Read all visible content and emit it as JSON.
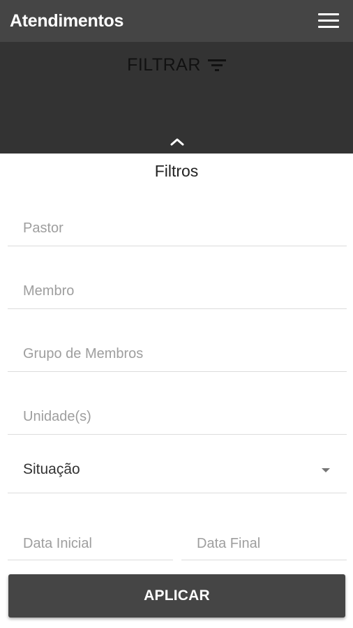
{
  "appbar": {
    "title": "Atendimentos",
    "menu_icon": "hamburger-menu-icon"
  },
  "filter_panel": {
    "label": "FILTRAR",
    "filter_icon": "filter-list-icon",
    "collapse_icon": "chevron-up-icon"
  },
  "form": {
    "title": "Filtros",
    "pastor": {
      "placeholder": "Pastor",
      "value": ""
    },
    "membro": {
      "placeholder": "Membro",
      "value": ""
    },
    "grupo": {
      "placeholder": "Grupo de Membros",
      "value": ""
    },
    "unidade": {
      "placeholder": "Unidade(s)",
      "value": ""
    },
    "situacao": {
      "value": "Situação",
      "icon": "dropdown-caret-icon"
    },
    "data_inicial": {
      "placeholder": "Data Inicial",
      "value": ""
    },
    "data_final": {
      "placeholder": "Data Final",
      "value": ""
    },
    "apply_label": "APLICAR"
  },
  "colors": {
    "appbar": "#454545",
    "panel": "#333333",
    "button": "#454545"
  }
}
